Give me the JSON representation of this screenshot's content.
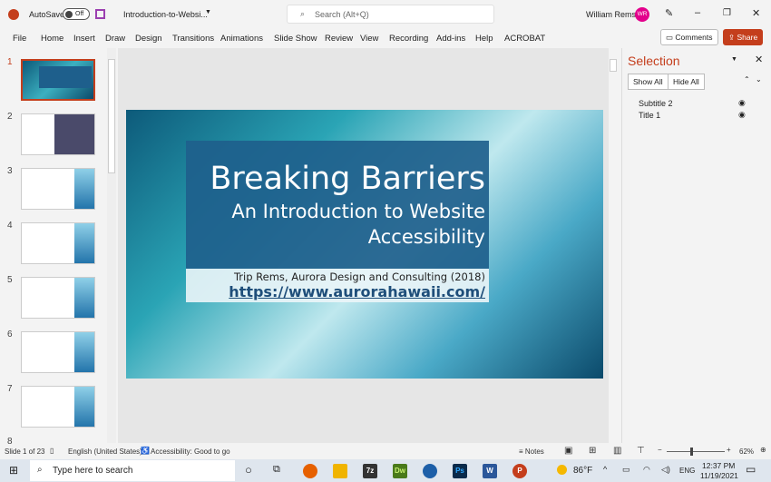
{
  "titlebar": {
    "autosave": "AutoSave",
    "toggle": "Off",
    "filename": "Introduction-to-Websi...",
    "search_placeholder": "Search (Alt+Q)",
    "user": "William Rems",
    "initials": "WR"
  },
  "ribbon": {
    "tabs": [
      "File",
      "Home",
      "Insert",
      "Draw",
      "Design",
      "Transitions",
      "Animations",
      "Slide Show",
      "Review",
      "View",
      "Recording",
      "Add-ins",
      "Help",
      "ACROBAT"
    ],
    "comments": "Comments",
    "share": "Share"
  },
  "thumbnails": [
    "1",
    "2",
    "3",
    "4",
    "5",
    "6",
    "7",
    "8"
  ],
  "slide": {
    "title": "Breaking Barriers",
    "subtitle1": "An Introduction to Website",
    "subtitle2": "Accessibility",
    "author": "Trip Rems, Aurora Design and Consulting (2018)",
    "url": "https://www.aurorahawaii.com/"
  },
  "selection": {
    "title": "Selection",
    "show_all": "Show All",
    "hide_all": "Hide All",
    "items": [
      "Subtitle 2",
      "Title 1"
    ]
  },
  "status": {
    "slide": "Slide 1 of 23",
    "language": "English (United States)",
    "accessibility": "Accessibility: Good to go",
    "notes": "Notes",
    "zoom": "62%",
    "zoom_fraction": 0.4
  },
  "taskbar": {
    "search": "Type here to search",
    "weather": "86°F",
    "lang": "ENG",
    "time": "12:37 PM",
    "date": "11/19/2021"
  },
  "colors": {
    "accent": "#c43e1c",
    "avatar": "#e3008c",
    "slide_box": "#1e5f8c"
  }
}
